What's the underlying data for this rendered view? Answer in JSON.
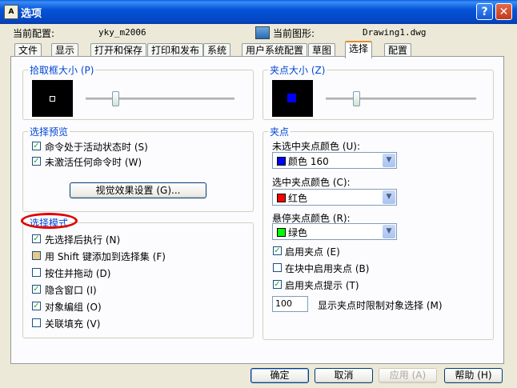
{
  "window": {
    "title": "选项",
    "help_label": "?",
    "close_label": "✕",
    "app_icon": "autocad-icon"
  },
  "header": {
    "current_config_label": "当前配置:",
    "current_config_value": "yky_m2006",
    "current_drawing_label": "当前图形:",
    "current_drawing_value": "Drawing1.dwg"
  },
  "tabs": [
    {
      "label": "文件"
    },
    {
      "label": "显示"
    },
    {
      "label": "打开和保存"
    },
    {
      "label": "打印和发布"
    },
    {
      "label": "系统"
    },
    {
      "label": "用户系统配置"
    },
    {
      "label": "草图"
    },
    {
      "label": "选择",
      "active": true
    },
    {
      "label": "配置"
    }
  ],
  "pickbox": {
    "title": "拾取框大小 (P)",
    "slider_fraction": 0.2
  },
  "grip_size": {
    "title": "夹点大小 (Z)",
    "slider_fraction": 0.2
  },
  "selection_preview": {
    "title": "选择预览",
    "items": [
      {
        "label": "命令处于活动状态时 (S)",
        "checked": true
      },
      {
        "label": "未激活任何命令时 (W)",
        "checked": true
      }
    ],
    "visual_button": "视觉效果设置 (G)..."
  },
  "selection_mode": {
    "title": "选择模式",
    "items": [
      {
        "label": "先选择后执行 (N)",
        "checked": true
      },
      {
        "label": "用 Shift 键添加到选择集 (F)",
        "checked": false,
        "partial": true
      },
      {
        "label": "按住并拖动 (D)",
        "checked": false
      },
      {
        "label": "隐含窗口 (I)",
        "checked": true
      },
      {
        "label": "对象编组 (O)",
        "checked": true
      },
      {
        "label": "关联填充 (V)",
        "checked": false
      }
    ]
  },
  "grips": {
    "title": "夹点",
    "unselected_label": "未选中夹点颜色 (U):",
    "unselected_value": "颜色 160",
    "unselected_color": "#0000ff",
    "selected_label": "选中夹点颜色 (C):",
    "selected_value": "红色",
    "selected_color": "#ff0000",
    "hover_label": "悬停夹点颜色 (R):",
    "hover_value": "绿色",
    "hover_color": "#00ff00",
    "checks": [
      {
        "label": "启用夹点 (E)",
        "checked": true
      },
      {
        "label": "在块中启用夹点 (B)",
        "checked": false
      },
      {
        "label": "启用夹点提示 (T)",
        "checked": true
      }
    ],
    "limit_value": "100",
    "limit_label": "显示夹点时限制对象选择 (M)"
  },
  "footer": {
    "ok": "确定",
    "cancel": "取消",
    "apply": "应用 (A)",
    "help": "帮助 (H)"
  },
  "colors": {
    "accent": "#0046d5",
    "title_bar": "#0454d8",
    "annotation": "#e00000"
  }
}
